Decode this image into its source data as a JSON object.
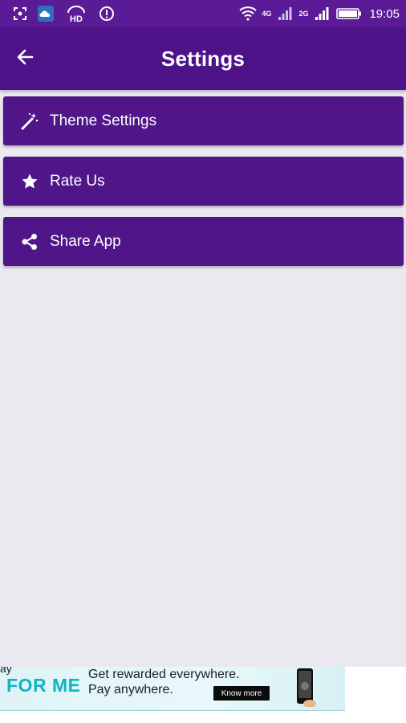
{
  "status_bar": {
    "time": "19:05",
    "network_1": "4G",
    "network_2": "2G",
    "hd_badge": "HD",
    "left_icons": [
      "screenshot-icon",
      "cloud-app-icon",
      "hd-icon",
      "alert-circle-icon"
    ],
    "right_icons": [
      "wifi-icon",
      "signal-icon",
      "signal-icon",
      "battery-icon"
    ]
  },
  "app_bar": {
    "title": "Settings",
    "back_icon": "arrow-left-icon"
  },
  "menu": [
    {
      "label": "Theme Settings",
      "icon": "magic-wand-icon"
    },
    {
      "label": "Rate Us",
      "icon": "star-icon"
    },
    {
      "label": "Share App",
      "icon": "share-icon"
    }
  ],
  "ad": {
    "brand_top": "ay",
    "brand": "FOR ME",
    "line1": "Get rewarded everywhere.",
    "line2": "Pay anywhere.",
    "cta": "Know more"
  },
  "colors": {
    "status_bar": "#5b1a96",
    "app_bar": "#4e1389",
    "menu_item": "#4f1589",
    "background": "#ebe9f0"
  }
}
